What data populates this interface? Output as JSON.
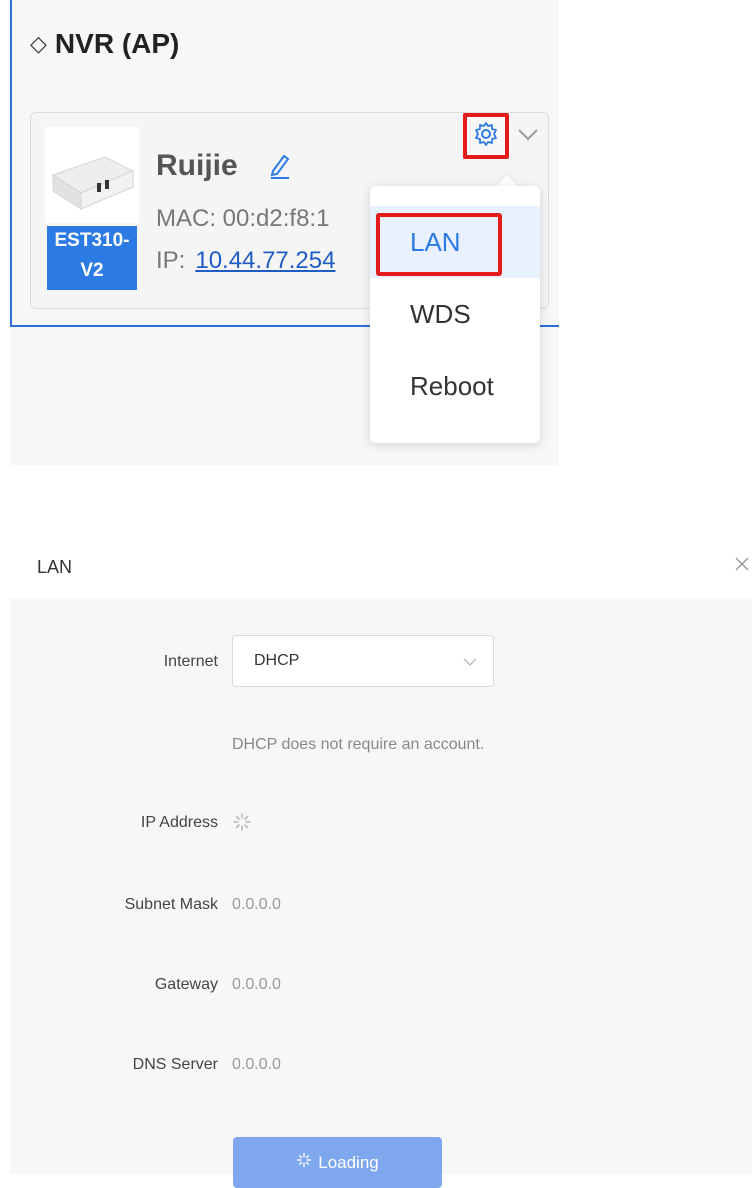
{
  "section": {
    "title": "NVR (AP)",
    "icon": "diamond-icon"
  },
  "device": {
    "name": "Ruijie",
    "model_line1": "EST310-",
    "model_line2": "V2",
    "mac_label": "MAC:",
    "mac_value": "00:d2:f8:1",
    "ip_label": "IP:",
    "ip_value": "10.44.77.254"
  },
  "menu": {
    "items": [
      {
        "label": "LAN"
      },
      {
        "label": "WDS"
      },
      {
        "label": "Reboot"
      }
    ]
  },
  "dialog": {
    "title": "LAN",
    "internet_label": "Internet",
    "internet_value": "DHCP",
    "hint": "DHCP does not require an account.",
    "ip_label": "IP Address",
    "subnet_label": "Subnet Mask",
    "subnet_value": "0.0.0.0",
    "gateway_label": "Gateway",
    "gateway_value": "0.0.0.0",
    "dns_label": "DNS Server",
    "dns_value": "0.0.0.0",
    "loading_label": "Loading"
  },
  "colors": {
    "accent": "#2c7be5",
    "highlight": "#e41b1b",
    "button": "#7ea7ee"
  }
}
